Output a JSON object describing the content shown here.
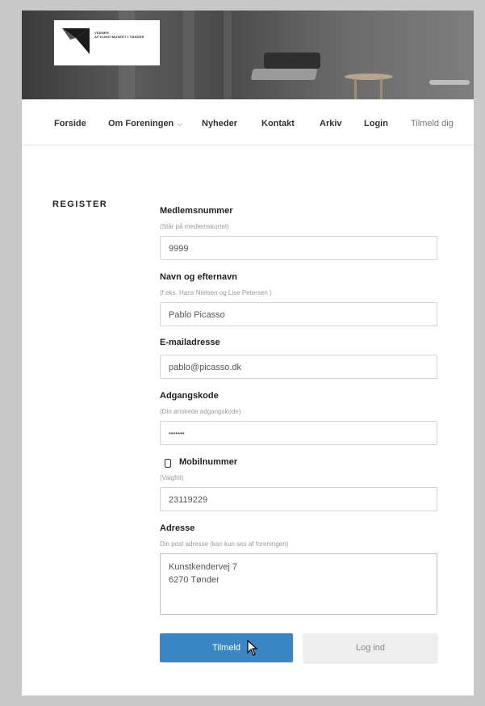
{
  "header": {
    "logo_text_lines": [
      "VENNER",
      "AF KUNSTMUSEET I TØNDER"
    ]
  },
  "nav": {
    "items": [
      {
        "label": "Forside"
      },
      {
        "label": "Om Foreningen",
        "has_dropdown": true
      },
      {
        "label": "Nyheder"
      },
      {
        "label": "Kontakt"
      },
      {
        "label": "Arkiv"
      },
      {
        "label": "Login"
      },
      {
        "label": "Tilmeld dig",
        "current": true
      }
    ]
  },
  "register": {
    "section_title": "REGISTER",
    "fields": {
      "member_number": {
        "label": "Medlemsnummer",
        "hint": "(Står på medlemskortet)",
        "value": "9999"
      },
      "name": {
        "label": "Navn og efternavn",
        "hint": "(f.eks. Hans Nielsen og Lise Petersen )",
        "value": "Pablo Picasso"
      },
      "email": {
        "label": "E-mailadresse",
        "value": "pablo@picasso.dk"
      },
      "password": {
        "label": "Adgangskode",
        "hint": "(Din ønskede adgangskode)",
        "value": "•••••••"
      },
      "mobile": {
        "label": "Mobilnummer",
        "hint": "(Valgfrit)",
        "value": "23119229",
        "icon": "mobile-phone-icon"
      },
      "address": {
        "label": "Adresse",
        "hint": "Din post adresse (kan kun ses af foreningen)",
        "line1": "Kunstkendervej 7",
        "line2": "6270 Tønder"
      }
    },
    "buttons": {
      "submit": "Tilmeld",
      "login": "Log ind"
    }
  },
  "colors": {
    "primary_button": "#3b87c5",
    "secondary_button": "#eeeeee",
    "background_frame": "#c8c8c8"
  }
}
